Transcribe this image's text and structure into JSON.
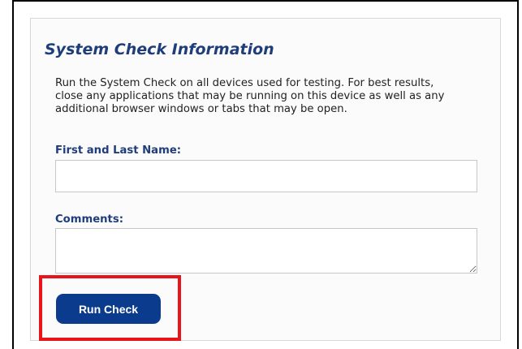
{
  "panel": {
    "title": "System Check Information",
    "description": "Run the System Check on all devices used for testing. For best results, close any applications that may be running on this device as well as any additional browser windows or tabs that may be open."
  },
  "form": {
    "name_label": "First and Last Name:",
    "name_value": "",
    "comments_label": "Comments:",
    "comments_value": ""
  },
  "actions": {
    "run_label": "Run Check"
  },
  "colors": {
    "title": "#1f3d7a",
    "button": "#0b3b8c",
    "highlight": "#e8131b"
  }
}
